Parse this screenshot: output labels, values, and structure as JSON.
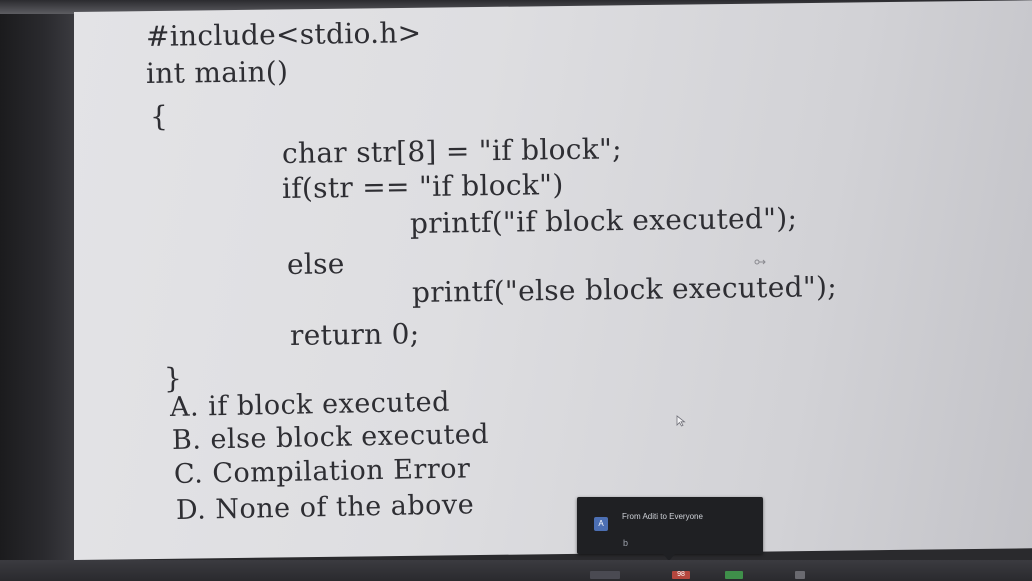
{
  "code": {
    "include": "#include<stdio.h>",
    "main_sig": "int main()",
    "open_brace": "{",
    "decl": "char str[8] = \"if block\";",
    "if_cond": "if(str == \"if block\")",
    "printf_if": "printf(\"if block executed\");",
    "else_kw": "else",
    "printf_else": "printf(\"else block executed\");",
    "return_stmt": "return 0;",
    "close_brace": "}"
  },
  "options": [
    {
      "label": "A. if block executed"
    },
    {
      "label": "B. else block executed"
    },
    {
      "label": "C. Compilation Error"
    },
    {
      "label": "D. None of the above"
    }
  ],
  "chat": {
    "header": "From Aditi to Everyone",
    "avatar_letter": "A",
    "message": "b"
  },
  "taskbar": {
    "badge": "98"
  },
  "icons": {
    "cursor": "mouse-pointer-icon",
    "link": "link-icon"
  },
  "colors": {
    "code_text": "#2e2e33",
    "chat_bg": "#1f2023",
    "avatar_bg": "#4c6fb3"
  }
}
